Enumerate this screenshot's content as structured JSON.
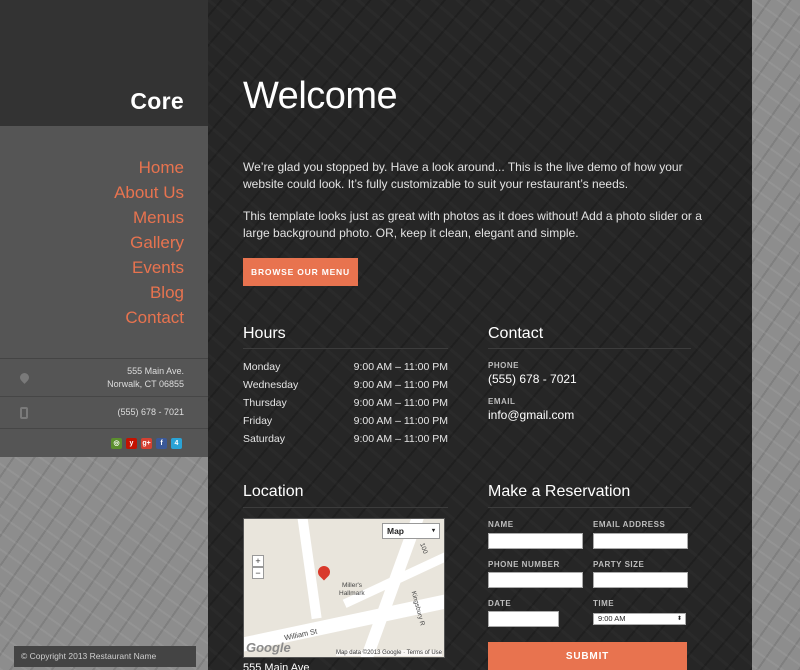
{
  "sidebar": {
    "brand": "Core",
    "nav": [
      "Home",
      "About Us",
      "Menus",
      "Gallery",
      "Events",
      "Blog",
      "Contact"
    ],
    "address_line1": "555 Main Ave.",
    "address_line2": "Norwalk, CT 06855",
    "phone": "(555) 678 - 7021",
    "social_icons": [
      "tripadvisor-icon",
      "yelp-icon",
      "google-plus-icon",
      "facebook-icon",
      "foursquare-icon"
    ],
    "copyright": "© Copyright 2013 Restaurant Name"
  },
  "main": {
    "title": "Welcome",
    "para1": "We’re glad you stopped by.  Have a look around...  This is the live demo of how your website could look.  It’s fully customizable to suit your restaurant’s needs.",
    "para2": "This template looks just as great with photos as it does without!  Add a photo slider or a large background photo.  OR, keep it clean, elegant and simple.",
    "browse_button": "BROWSE OUR MENU"
  },
  "hours": {
    "title": "Hours",
    "rows": [
      {
        "day": "Monday",
        "time": "9:00 AM – 11:00 PM"
      },
      {
        "day": "Wednesday",
        "time": "9:00 AM – 11:00 PM"
      },
      {
        "day": "Thursday",
        "time": "9:00 AM – 11:00 PM"
      },
      {
        "day": "Friday",
        "time": "9:00 AM – 11:00 PM"
      },
      {
        "day": "Saturday",
        "time": "9:00 AM – 11:00 PM"
      }
    ]
  },
  "contact": {
    "title": "Contact",
    "phone_label": "PHONE",
    "phone": "(555) 678 - 7021",
    "email_label": "EMAIL",
    "email": "info@gmail.com"
  },
  "location": {
    "title": "Location",
    "map_type": "Map",
    "place_label_1": "Miller's",
    "place_label_2": "Hallmark",
    "street_1": "William St",
    "street_2": "Kingsbury R",
    "street_3": "100",
    "map_brand": "Google",
    "map_data": "Map data ©2013 Google · Terms of Use",
    "address": "555 Main Ave"
  },
  "reservation": {
    "title": "Make a Reservation",
    "name_label": "NAME",
    "email_label": "EMAIL ADDRESS",
    "phone_label": "PHONE NUMBER",
    "party_label": "PARTY SIZE",
    "date_label": "DATE",
    "time_label": "TIME",
    "time_value": "9:00 AM",
    "submit": "SUBMIT"
  },
  "colors": {
    "accent": "#e8734f",
    "main_bg": "#262626",
    "sidebar_dark": "#333333",
    "sidebar_mid": "#555555"
  }
}
